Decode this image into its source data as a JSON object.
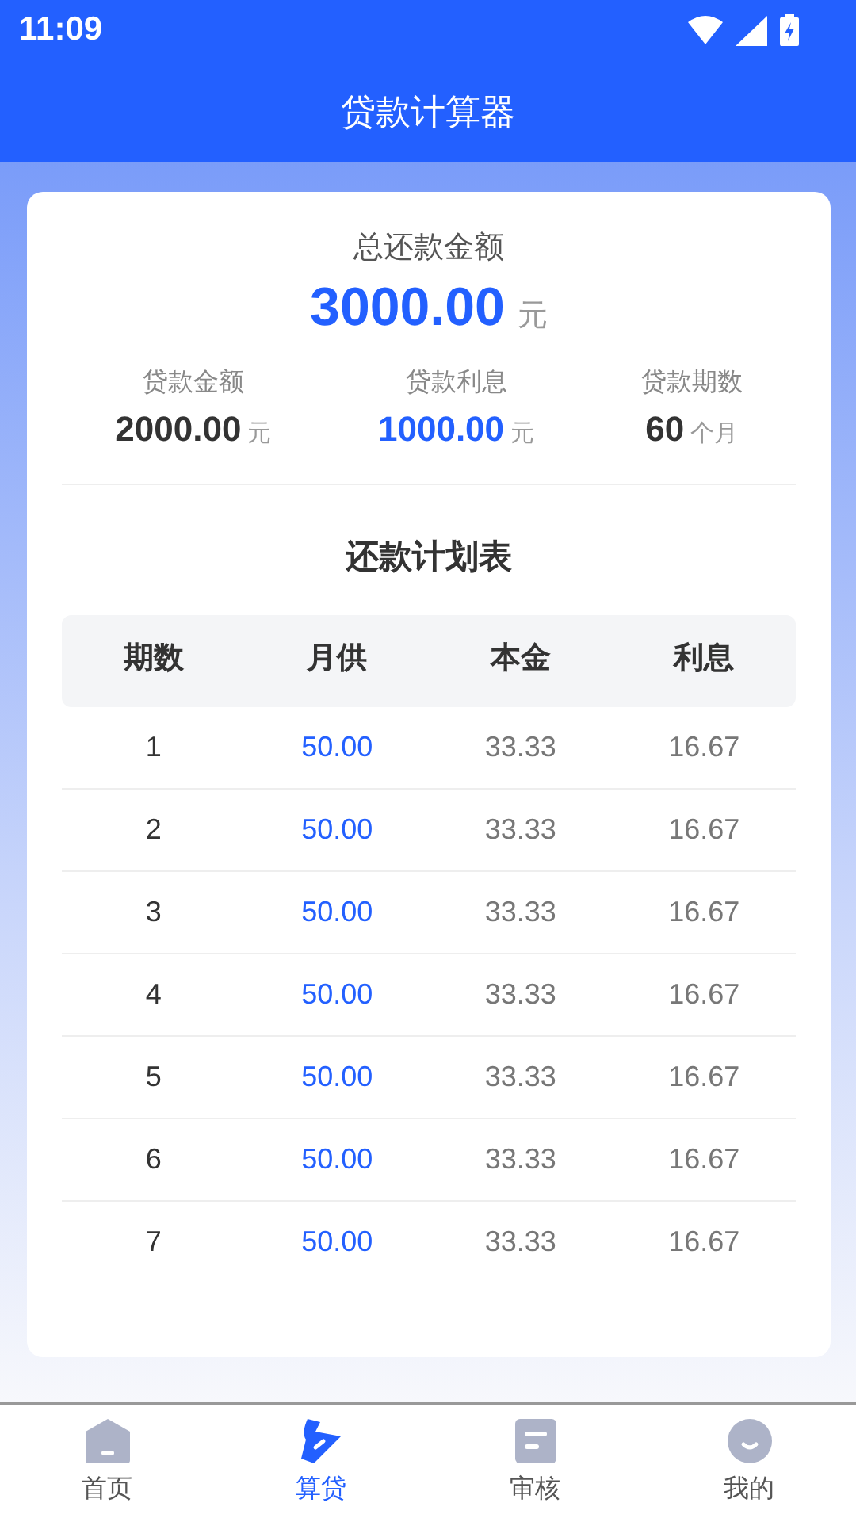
{
  "status_bar": {
    "time": "11:09"
  },
  "header": {
    "title": "贷款计算器"
  },
  "summary": {
    "label": "总还款金额",
    "value": "3000.00",
    "unit": "元"
  },
  "stats": [
    {
      "label": "贷款金额",
      "value": "2000.00",
      "unit": "元",
      "highlight": false
    },
    {
      "label": "贷款利息",
      "value": "1000.00",
      "unit": "元",
      "highlight": true
    },
    {
      "label": "贷款期数",
      "value": "60",
      "unit": "个月",
      "highlight": false
    }
  ],
  "schedule": {
    "title": "还款计划表",
    "columns": [
      "期数",
      "月供",
      "本金",
      "利息"
    ],
    "rows": [
      [
        "1",
        "50.00",
        "33.33",
        "16.67"
      ],
      [
        "2",
        "50.00",
        "33.33",
        "16.67"
      ],
      [
        "3",
        "50.00",
        "33.33",
        "16.67"
      ],
      [
        "4",
        "50.00",
        "33.33",
        "16.67"
      ],
      [
        "5",
        "50.00",
        "33.33",
        "16.67"
      ],
      [
        "6",
        "50.00",
        "33.33",
        "16.67"
      ],
      [
        "7",
        "50.00",
        "33.33",
        "16.67"
      ]
    ]
  },
  "tab_bar": [
    {
      "kind": "home",
      "label": "首页",
      "selected": false
    },
    {
      "kind": "calc",
      "label": "算贷",
      "selected": true
    },
    {
      "kind": "review",
      "label": "审核",
      "selected": false
    },
    {
      "kind": "me",
      "label": "我的",
      "selected": false
    }
  ]
}
